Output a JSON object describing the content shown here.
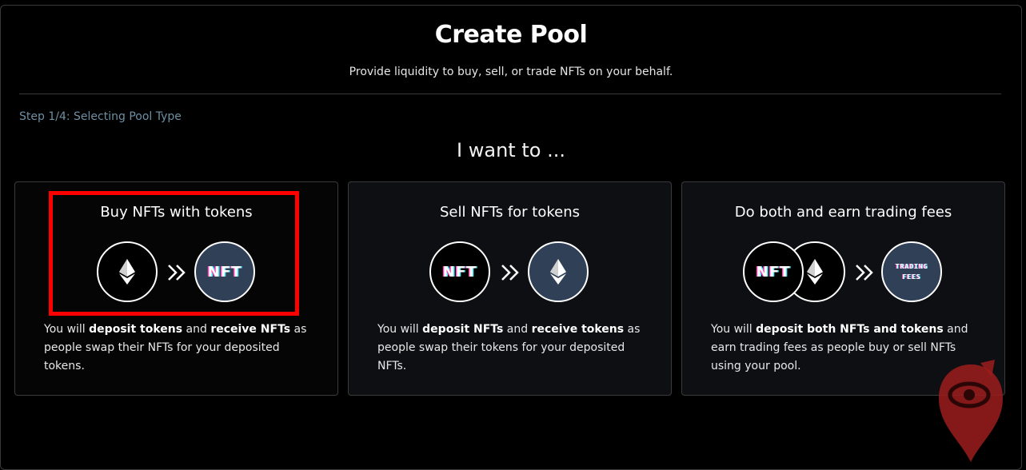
{
  "header": {
    "title": "Create Pool",
    "subtitle": "Provide liquidity to buy, sell, or trade NFTs on your behalf."
  },
  "step": "Step 1/4: Selecting Pool Type",
  "prompt": "I want to ...",
  "cards": [
    {
      "title": "Buy NFTs with tokens",
      "desc_parts": [
        "You will ",
        "deposit tokens",
        " and ",
        "receive NFTs",
        " as people swap their NFTs for your deposited tokens."
      ]
    },
    {
      "title": "Sell NFTs for tokens",
      "desc_parts": [
        "You will ",
        "deposit NFTs",
        " and ",
        "receive tokens",
        " as people swap their tokens for your deposited NFTs."
      ]
    },
    {
      "title": "Do both and earn trading fees",
      "desc_parts": [
        "You will ",
        "deposit both NFTs and tokens",
        " and earn trading fees as people buy or sell NFTs using your pool."
      ]
    }
  ],
  "icons": {
    "nft_label": "NFT",
    "fees_line1": "TRADING",
    "fees_line2": "FEES",
    "eth": "eth-icon",
    "arrows": "double-chevron-right-icon",
    "watermark": "location-pin-eye-icon"
  },
  "colors": {
    "background": "#000000",
    "step_text": "#6f8fa3",
    "highlight": "#ff0000",
    "token_circle": "#2f4057"
  }
}
